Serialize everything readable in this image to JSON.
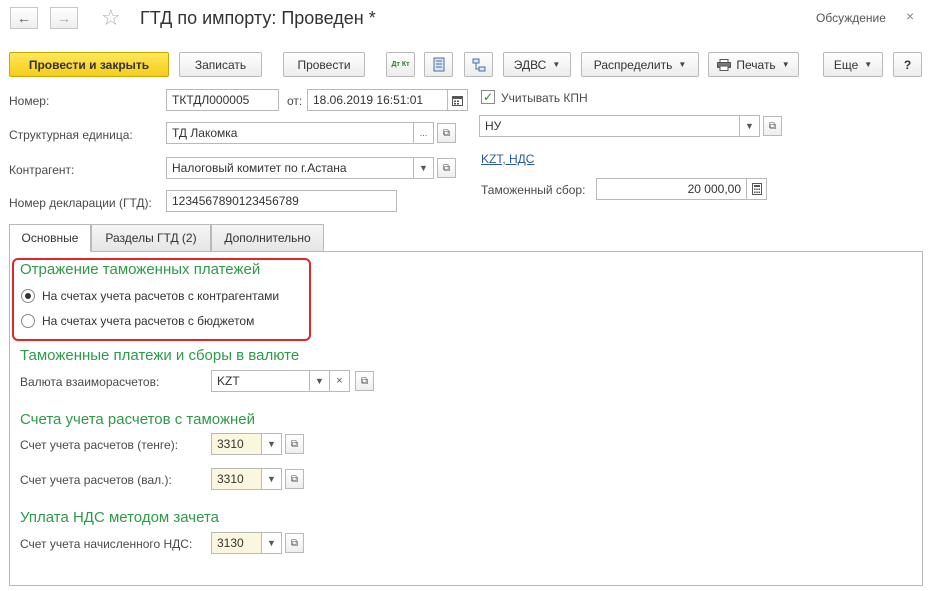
{
  "header": {
    "title": "ГТД по импорту: Проведен *",
    "discussion": "Обсуждение",
    "back_glyph": "←",
    "forward_glyph": "→",
    "star_glyph": "☆",
    "close_glyph": "×"
  },
  "toolbar": {
    "post_close": "Провести и закрыть",
    "save": "Записать",
    "post": "Провести",
    "dt_kt": "Дт Кт",
    "edvs": "ЭДВС",
    "distribute": "Распределить",
    "print": "Печать",
    "more": "Еще",
    "help": "?"
  },
  "form": {
    "number_label": "Номер:",
    "number_value": "ТКТДЛ000005",
    "from_label": "от:",
    "date_value": "18.06.2019 16:51:01",
    "unit_label": "Структурная единица:",
    "unit_value": "ТД Лакомка",
    "counterparty_label": "Контрагент:",
    "counterparty_value": "Налоговый комитет по г.Астана",
    "declaration_label": "Номер декларации (ГТД):",
    "declaration_value": "1234567890123456789",
    "kpn_label": "Учитывать КПН",
    "kpn_checked": true,
    "nu_value": "НУ",
    "currency_link": "KZT, НДС",
    "customs_fee_label": "Таможенный сбор:",
    "customs_fee_value": "20 000,00"
  },
  "tabs": [
    {
      "label": "Основные",
      "active": true
    },
    {
      "label": "Разделы ГТД (2)",
      "active": false
    },
    {
      "label": "Дополнительно",
      "active": false
    }
  ],
  "main": {
    "payments_section": "Отражение таможенных платежей",
    "radio_options": [
      {
        "label": "На счетах учета расчетов с контрагентами",
        "selected": true
      },
      {
        "label": "На счетах учета расчетов с бюджетом",
        "selected": false
      }
    ],
    "currency_section": "Таможенные платежи и сборы в валюте",
    "settlement_currency_label": "Валюта взаиморасчетов:",
    "settlement_currency_value": "KZT",
    "accounts_section": "Счета учета расчетов с таможней",
    "account_tenge_label": "Счет учета расчетов (тенге):",
    "account_tenge_value": "3310",
    "account_val_label": "Счет учета расчетов (вал.):",
    "account_val_value": "3310",
    "vat_section": "Уплата НДС методом зачета",
    "vat_account_label": "Счет учета начисленного НДС:",
    "vat_account_value": "3130"
  },
  "colors": {
    "accent_yellow": "#f5cc1a",
    "section_green": "#2e9a48",
    "highlight_red": "#e02626",
    "link_blue": "#2a5aa0"
  }
}
